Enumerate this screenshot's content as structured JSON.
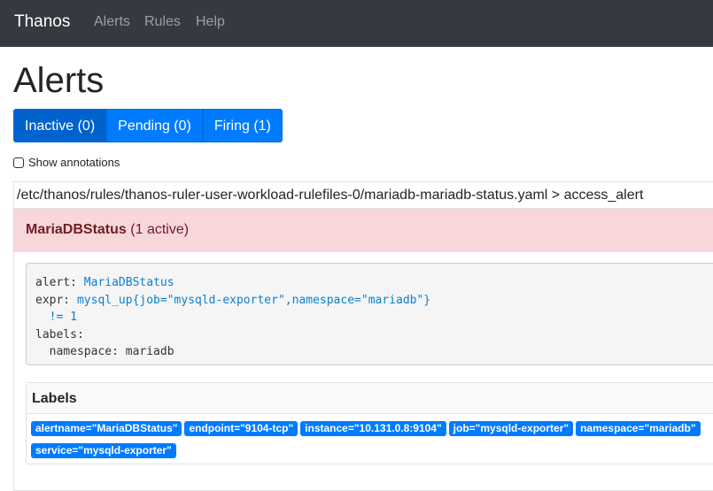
{
  "navbar": {
    "brand": "Thanos",
    "links": [
      "Alerts",
      "Rules",
      "Help"
    ],
    "bg_color": "#343a40"
  },
  "page": {
    "title": "Alerts"
  },
  "state_filters": [
    {
      "label": "Inactive (0)"
    },
    {
      "label": "Pending (0)"
    },
    {
      "label": "Firing (1)"
    }
  ],
  "annotations_toggle": {
    "label": "Show annotations",
    "checked": false
  },
  "rule_group": {
    "header": "/etc/thanos/rules/thanos-ruler-user-workload-rulefiles-0/mariadb-mariadb-status.yaml > access_alert"
  },
  "alert": {
    "name": "MariaDBStatus",
    "active_text": "(1 active)",
    "bg_color": "#f8d7da",
    "rule": {
      "alert_key": "alert:",
      "alert_value": "MariaDBStatus",
      "expr_key": "expr:",
      "expr_value_line1": "mysql_up{job=\"mysqld-exporter\",namespace=\"mariadb\"}",
      "expr_value_line2": "!= 1",
      "labels_key": "labels:",
      "label_line": "namespace: mariadb"
    },
    "labels_title": "Labels",
    "labels": [
      "alertname=\"MariaDBStatus\"",
      "endpoint=\"9104-tcp\"",
      "instance=\"10.131.0.8:9104\"",
      "job=\"mysqld-exporter\"",
      "namespace=\"mariadb\"",
      "service=\"mysqld-exporter\""
    ]
  },
  "colors": {
    "accent": "#007bff"
  }
}
